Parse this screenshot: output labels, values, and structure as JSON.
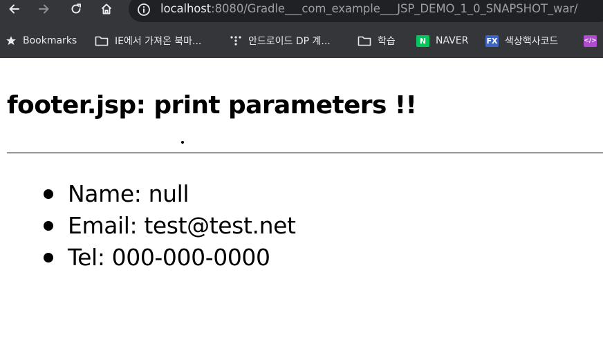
{
  "browser": {
    "url_host": "localhost",
    "url_rest": ":8080/Gradle___com_example___JSP_DEMO_1_0_SNAPSHOT_war/",
    "nav_icons": [
      "back-arrow-icon",
      "forward-arrow-icon",
      "reload-icon",
      "home-icon",
      "info-icon"
    ]
  },
  "bookmarks": {
    "items": [
      {
        "label": "Bookmarks",
        "icon": "star-icon"
      },
      {
        "label": "IE에서 가져온 북마...",
        "icon": "folder-icon"
      },
      {
        "label": "안드로이드 DP 계...",
        "icon": "dots-icon"
      },
      {
        "label": "학습",
        "icon": "folder-icon"
      },
      {
        "label": "NAVER",
        "icon": "naver-icon",
        "badge": "N",
        "badge_color": "#03c75a"
      },
      {
        "label": "색상핵사코드",
        "icon": "fx-icon",
        "badge": "FX",
        "badge_color": "#3f65c4"
      },
      {
        "label": "",
        "icon": "code-icon",
        "badge": "</>",
        "badge_color": "#b04ad0"
      }
    ]
  },
  "page": {
    "title": "footer.jsp: print parameters !!",
    "params": [
      "Name: null",
      "Email: test@test.net",
      "Tel: 000-000-0000"
    ]
  },
  "colors": {
    "toolbar_bg": "#35363a",
    "omnibox_bg": "#202124",
    "text_light": "#e8eaed",
    "text_dim": "#9aa0a6"
  }
}
